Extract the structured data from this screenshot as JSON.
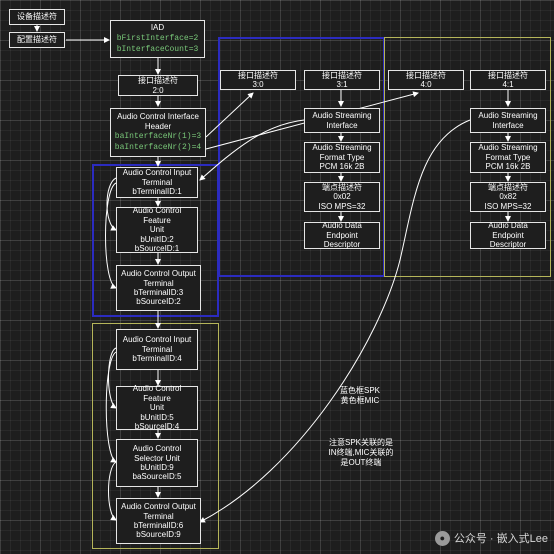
{
  "diagram": {
    "nodes": {
      "device_desc": "设备描述符",
      "config_desc": "配置描述符",
      "iad": {
        "title": "IAD",
        "f1": "bFirstInterface=2",
        "f2": "bInterfaceCount=3"
      },
      "if20": {
        "l1": "接口描述符",
        "l2": "2:0"
      },
      "ac_header": {
        "l1": "Audio Control Interface",
        "l2": "Header",
        "f1": "baInterfaceNr(1)=3",
        "f2": "baInterfaceNr(2)=4"
      },
      "it1": {
        "l1": "Audio Control Input",
        "l2": "Terminal",
        "l3": "bTerminalID:1"
      },
      "fu2": {
        "l1": "Audio Control Feature",
        "l2": "Unit",
        "l3": "bUnitID:2",
        "l4": "bSourceID:1"
      },
      "ot3": {
        "l1": "Audio Control Output",
        "l2": "Terminal",
        "l3": "bTerminalID:3",
        "l4": "bSourceID:2"
      },
      "it4": {
        "l1": "Audio Control Input",
        "l2": "Terminal",
        "l3": "bTerminalID:4"
      },
      "fu5": {
        "l1": "Audio Control Feature",
        "l2": "Unit",
        "l3": "bUnitID:5",
        "l4": "bSourceID:4"
      },
      "su9": {
        "l1": "Audio Control",
        "l2": "Selector Unit",
        "l3": "bUnitID:9",
        "l4": "baSourceID:5"
      },
      "ot6": {
        "l1": "Audio Control Output",
        "l2": "Terminal",
        "l3": "bTerminalID:6",
        "l4": "bSourceID:9"
      },
      "if30": {
        "l1": "接口描述符",
        "l2": "3:0"
      },
      "if31": {
        "l1": "接口描述符",
        "l2": "3:1"
      },
      "as31": {
        "l1": "Audio Streaming",
        "l2": "Interface"
      },
      "fmt31": {
        "l1": "Audio Streaming",
        "l2": "Format Type",
        "l3": "PCM 16k 2B"
      },
      "ep31": {
        "l1": "端点描述符",
        "l2": "0x02",
        "l3": "ISO MPS=32"
      },
      "adep31": {
        "l1": "Audio Data Endpoint",
        "l2": "Descriptor"
      },
      "if40": {
        "l1": "接口描述符",
        "l2": "4:0"
      },
      "if41": {
        "l1": "接口描述符",
        "l2": "4:1"
      },
      "as41": {
        "l1": "Audio Streaming",
        "l2": "Interface"
      },
      "fmt41": {
        "l1": "Audio Streaming",
        "l2": "Format Type",
        "l3": "PCM 16k 2B"
      },
      "ep41": {
        "l1": "端点描述符",
        "l2": "0x82",
        "l3": "ISO MPS=32"
      },
      "adep41": {
        "l1": "Audio Data Endpoint",
        "l2": "Descriptor"
      }
    },
    "notes": {
      "legend_l1": "蓝色框SPK",
      "legend_l2": "黄色框MIC",
      "remark_l1": "注意SPK关联的是",
      "remark_l2": "IN终端,MIC关联的",
      "remark_l3": "是OUT终端"
    },
    "watermark": {
      "text": "公众号 · 嵌入式Lee",
      "icon": "wechat-icon"
    },
    "colors": {
      "spk_group": "#2b2bbf",
      "mic_group": "#b5b55a",
      "field_text": "#79c879",
      "line": "#ffffff"
    }
  }
}
